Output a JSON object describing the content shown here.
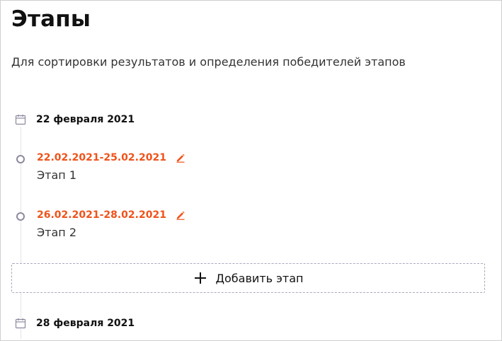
{
  "page": {
    "title": "Этапы",
    "subtitle": "Для сортировки результатов и определения победителей этапов"
  },
  "timeline": {
    "groups": [
      {
        "date": "22 февраля 2021",
        "icon": "calendar-icon",
        "stages": [
          {
            "dates": "22.02.2021-25.02.2021",
            "name": "Этап 1",
            "edit_icon": "pencil-icon"
          },
          {
            "dates": "26.02.2021-28.02.2021",
            "name": "Этап 2",
            "edit_icon": "pencil-icon"
          }
        ],
        "add_button": {
          "label": "Добавить этап",
          "icon": "plus-icon"
        }
      },
      {
        "date": "28 февраля 2021",
        "icon": "calendar-icon",
        "stages": []
      }
    ]
  },
  "colors": {
    "accent": "#f0521a",
    "text": "#111111",
    "muted": "#8a8aa0",
    "dashed_border": "#a9a9c0"
  }
}
